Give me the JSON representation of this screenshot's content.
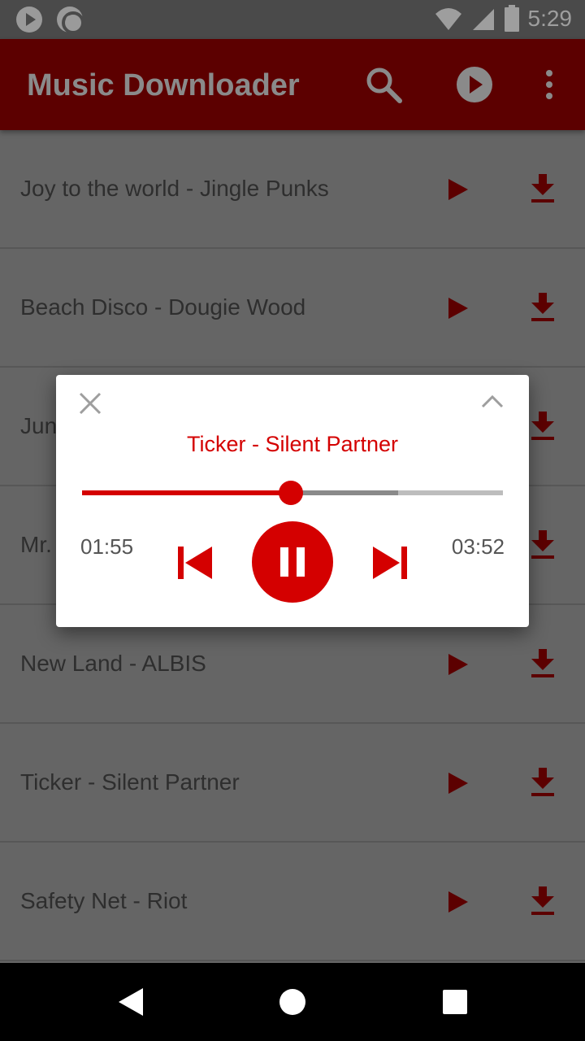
{
  "status_bar": {
    "time": "5:29",
    "icons": [
      "play-notification-icon",
      "record-notification-icon",
      "wifi-icon",
      "signal-icon",
      "battery-icon"
    ]
  },
  "app_bar": {
    "title": "Music Downloader",
    "actions": [
      "search-icon",
      "play-circle-icon",
      "more-vert-icon"
    ]
  },
  "songs": [
    {
      "title": "Joy to the world - Jingle Punks"
    },
    {
      "title": "Beach Disco - Dougie Wood"
    },
    {
      "title": "Jun"
    },
    {
      "title": "Mr."
    },
    {
      "title": "New Land - ALBIS"
    },
    {
      "title": "Ticker - Silent Partner"
    },
    {
      "title": "Safety Net - Riot"
    }
  ],
  "player": {
    "track_title": "Ticker - Silent Partner",
    "elapsed": "01:55",
    "total": "03:52",
    "progress_fraction": 0.496,
    "buffered_fraction": 0.75,
    "icons": [
      "close-icon",
      "chevron-up-icon",
      "skip-previous-icon",
      "pause-icon",
      "skip-next-icon"
    ]
  },
  "colors": {
    "accent": "#d40000",
    "app_bar": "#5c0000",
    "dim_overlay_bg": "#656565"
  }
}
